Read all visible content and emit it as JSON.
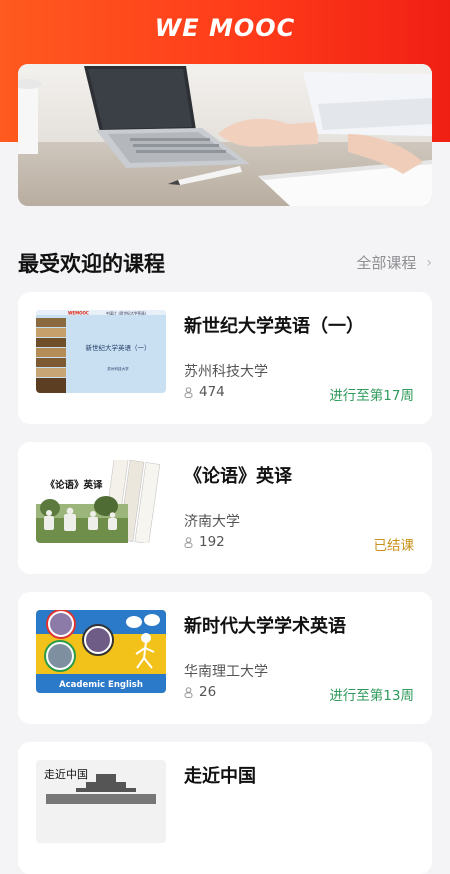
{
  "app": {
    "logo": "WE MOOC"
  },
  "section": {
    "title": "最受欢迎的课程",
    "all_label": "全部课程",
    "chevron": "›"
  },
  "courses": [
    {
      "title": "新世纪大学英语（一）",
      "school": "苏州科技大学",
      "learners": "474",
      "status": "进行至第17周",
      "status_color": "#2f9a5a",
      "thumb": {
        "logo": "WEMOOC",
        "header": "中国计《新世纪大学英语》",
        "title": "新世纪大学英语（一）",
        "school": "苏州科技大学"
      }
    },
    {
      "title": "《论语》英译",
      "school": "济南大学",
      "learners": "192",
      "status": "已结课",
      "status_color": "#c9911a",
      "thumb": {
        "title": "《论语》英译"
      }
    },
    {
      "title": "新时代大学学术英语",
      "school": "华南理工大学",
      "learners": "26",
      "status": "进行至第13周",
      "status_color": "#2f9a5a",
      "thumb": {
        "caption": "Academic English"
      }
    },
    {
      "title": "走近中国",
      "thumb": {
        "title": "走近中国"
      }
    }
  ],
  "colors": {
    "brand": "#ff3b1a",
    "ongoing": "#2f9a5a",
    "ended": "#c9911a"
  },
  "icons": {
    "learners": "person-icon",
    "chevron": "chevron-right-icon"
  }
}
